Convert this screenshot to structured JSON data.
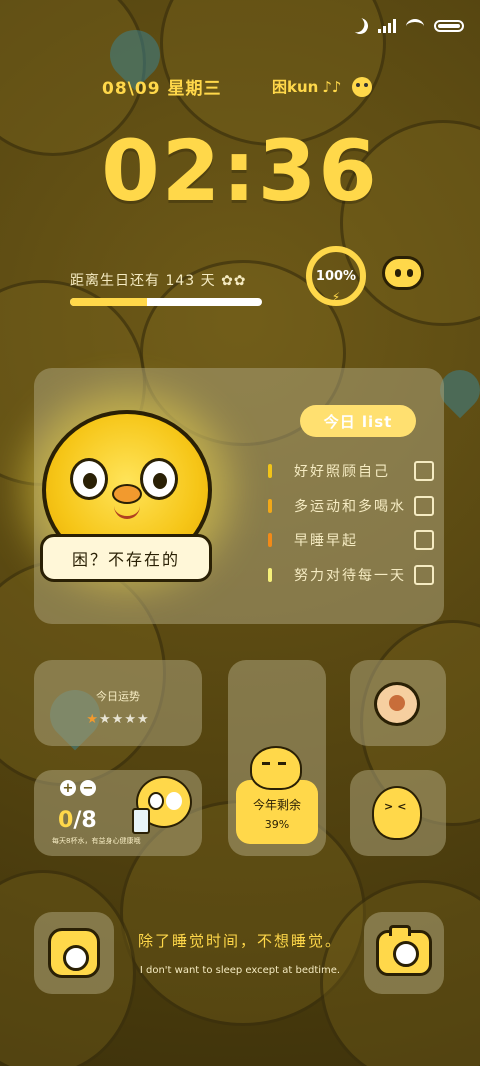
{
  "date": "08\\09 星期三",
  "user": "困kun",
  "clock": "02:36",
  "birthday": {
    "label": "距离生日还有  143 天",
    "progress": 0.4
  },
  "battery": {
    "percent": "100%"
  },
  "todo": {
    "title": "今日 list",
    "items": [
      {
        "label": "好好照顾自己",
        "color": "#f2c418"
      },
      {
        "label": "多运动和多喝水",
        "color": "#f2a818"
      },
      {
        "label": "早睡早起",
        "color": "#f28a18"
      },
      {
        "label": "努力对待每一天",
        "color": "#f6f07a"
      }
    ]
  },
  "mascot_caption": "困？不存在的",
  "luck": {
    "title": "今日运势",
    "rating": 1,
    "max": 5
  },
  "year": {
    "label": "今年剩余",
    "percent": "39%"
  },
  "water": {
    "current": "0",
    "total": "/8",
    "tip": "每天8杯水，有益身心健康哦"
  },
  "quote": {
    "zh": "除了睡觉时间，不想睡觉。",
    "en": "I don't want to sleep except at bedtime."
  }
}
